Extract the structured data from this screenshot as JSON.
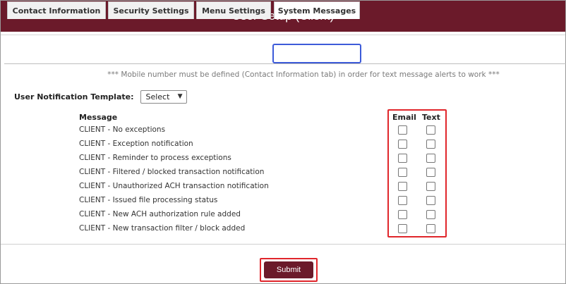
{
  "header": {
    "title": "User Setup (Client)"
  },
  "tabs": [
    {
      "label": "Contact Information",
      "active": false
    },
    {
      "label": "Security Settings",
      "active": false
    },
    {
      "label": "Menu Settings",
      "active": false
    },
    {
      "label": "System Messages",
      "active": true
    }
  ],
  "notice": "*** Mobile number must be defined (Contact Information tab) in order for text message alerts to work ***",
  "template": {
    "label": "User Notification Template:",
    "selected": "Select"
  },
  "table": {
    "message_header": "Message",
    "email_header": "Email",
    "text_header": "Text",
    "rows": [
      {
        "message": "CLIENT - No exceptions",
        "email": false,
        "text": false
      },
      {
        "message": "CLIENT - Exception notification",
        "email": false,
        "text": false
      },
      {
        "message": "CLIENT - Reminder to process exceptions",
        "email": false,
        "text": false
      },
      {
        "message": "CLIENT - Filtered / blocked transaction notification",
        "email": false,
        "text": false
      },
      {
        "message": "CLIENT - Unauthorized ACH transaction notification",
        "email": false,
        "text": false
      },
      {
        "message": "CLIENT - Issued file processing status",
        "email": false,
        "text": false
      },
      {
        "message": "CLIENT - New ACH authorization rule added",
        "email": false,
        "text": false
      },
      {
        "message": "CLIENT - New transaction filter / block added",
        "email": false,
        "text": false
      }
    ]
  },
  "submit_label": "Submit",
  "colors": {
    "brand": "#6b1a2a",
    "tab_highlight": "#3d5bd9",
    "annotation": "#e0262b"
  }
}
